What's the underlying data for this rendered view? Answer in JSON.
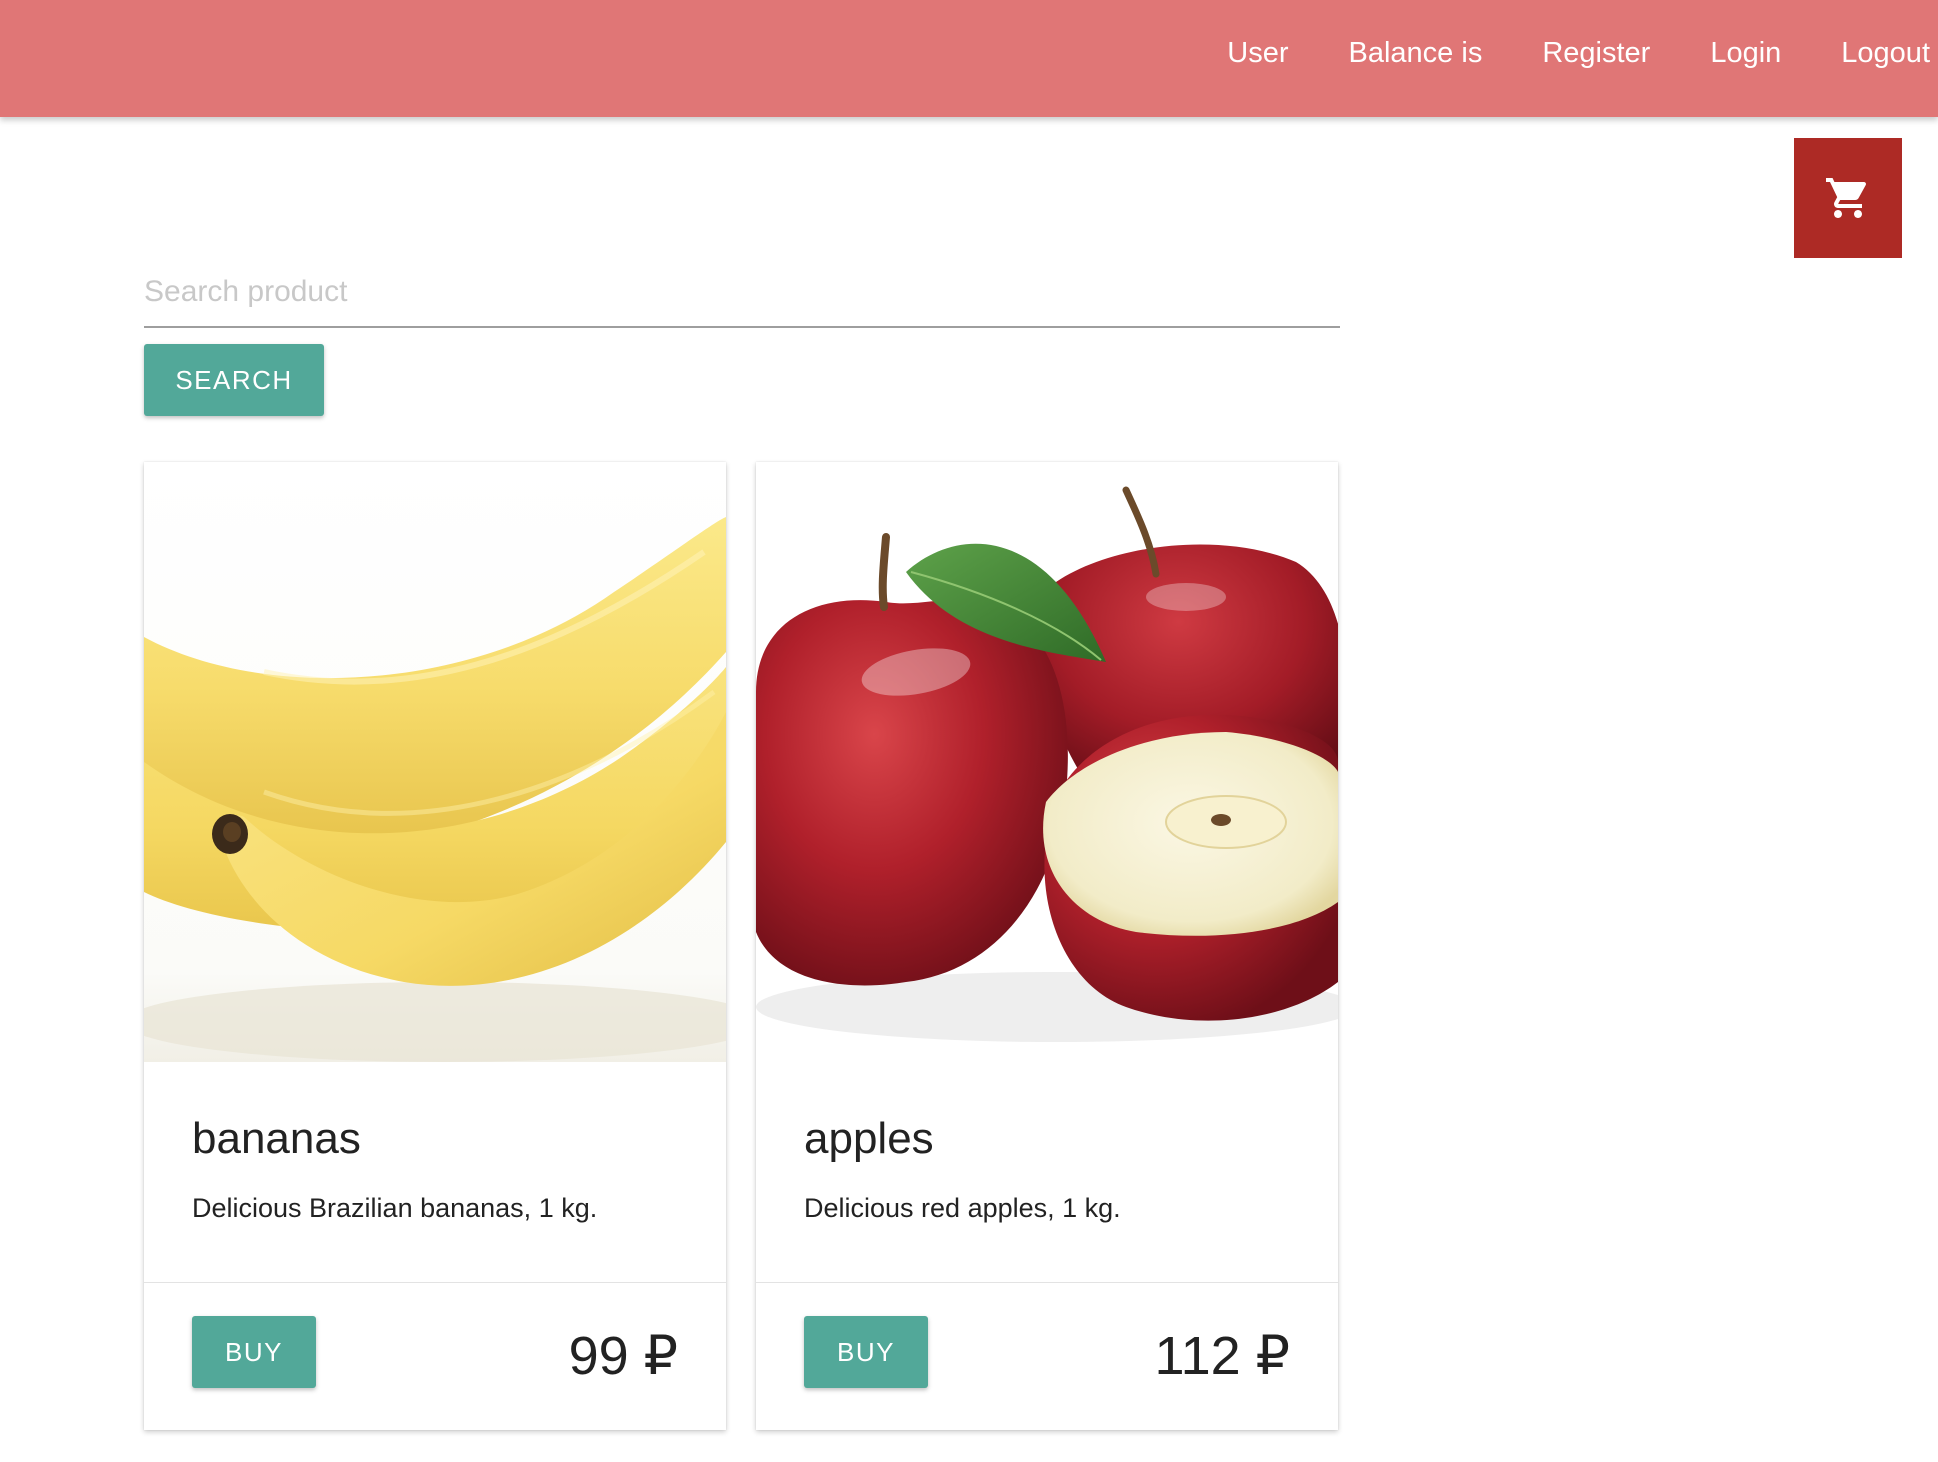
{
  "navbar": {
    "background": "#e07676",
    "links": [
      {
        "label": "User"
      },
      {
        "label": "Balance is"
      },
      {
        "label": "Register"
      },
      {
        "label": "Login"
      },
      {
        "label": "Logout"
      }
    ]
  },
  "cart": {
    "icon": "shopping-cart-icon",
    "color": "#ad2a25"
  },
  "search": {
    "value": "",
    "placeholder": "Search product",
    "button_label": "SEARCH"
  },
  "accent_color": "#52a899",
  "products": [
    {
      "name": "bananas",
      "description": "Delicious Brazilian bananas, 1 kg.",
      "price": "99 ₽",
      "buy_label": "BUY",
      "image": "bananas-image"
    },
    {
      "name": "apples",
      "description": "Delicious red apples, 1 kg.",
      "price": "112 ₽",
      "buy_label": "BUY",
      "image": "apples-image"
    }
  ]
}
